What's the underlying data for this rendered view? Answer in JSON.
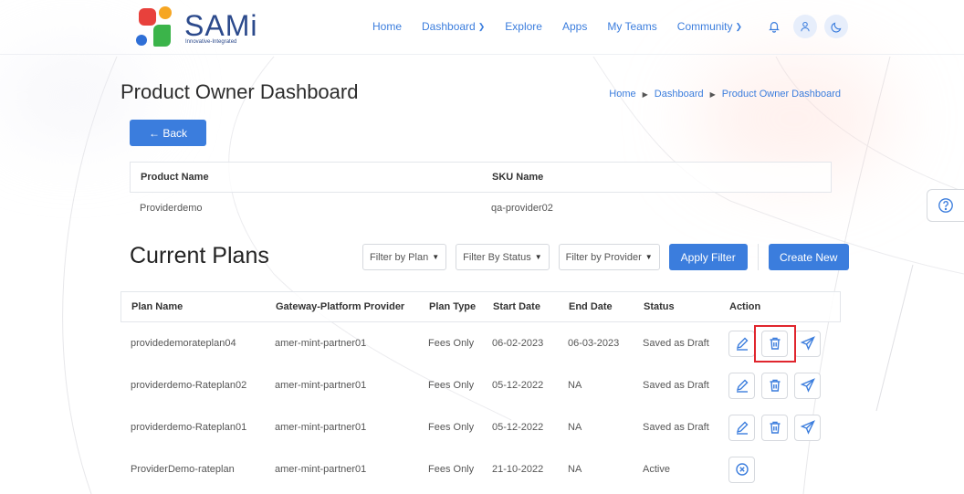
{
  "brand": {
    "name": "SAMi",
    "tagline": "Innovative-Integrated"
  },
  "nav": {
    "items": [
      {
        "label": "Home",
        "dropdown": false
      },
      {
        "label": "Dashboard",
        "dropdown": true
      },
      {
        "label": "Explore",
        "dropdown": false
      },
      {
        "label": "Apps",
        "dropdown": false
      },
      {
        "label": "My Teams",
        "dropdown": false
      },
      {
        "label": "Community",
        "dropdown": true
      }
    ],
    "icons": [
      "bell-icon",
      "user-icon",
      "moon-icon"
    ]
  },
  "page": {
    "title": "Product Owner Dashboard"
  },
  "breadcrumb": [
    "Home",
    "Dashboard",
    "Product Owner Dashboard"
  ],
  "back_button": "← Back",
  "product": {
    "headers": [
      "Product Name",
      "SKU Name"
    ],
    "values": [
      "Providerdemo",
      "qa-provider02"
    ]
  },
  "plans_section": {
    "title": "Current Plans",
    "filters": [
      "Filter by Plan",
      "Filter By Status",
      "Filter by Provider"
    ],
    "apply_label": "Apply Filter",
    "create_label": "Create New"
  },
  "plans_table": {
    "headers": [
      "Plan Name",
      "Gateway-Platform Provider",
      "Plan Type",
      "Start Date",
      "End Date",
      "Status",
      "Action"
    ],
    "rows": [
      {
        "plan": "providedemorateplan04",
        "provider": "amer-mint-partner01",
        "type": "Fees Only",
        "start": "06-02-2023",
        "end": "06-03-2023",
        "status": "Saved as Draft",
        "actions": [
          "edit",
          "delete",
          "send"
        ]
      },
      {
        "plan": "providerdemo-Rateplan02",
        "provider": "amer-mint-partner01",
        "type": "Fees Only",
        "start": "05-12-2022",
        "end": "NA",
        "status": "Saved as Draft",
        "actions": [
          "edit",
          "delete",
          "send"
        ]
      },
      {
        "plan": "providerdemo-Rateplan01",
        "provider": "amer-mint-partner01",
        "type": "Fees Only",
        "start": "05-12-2022",
        "end": "NA",
        "status": "Saved as Draft",
        "actions": [
          "edit",
          "delete",
          "send"
        ]
      },
      {
        "plan": "ProviderDemo-rateplan",
        "provider": "amer-mint-partner01",
        "type": "Fees Only",
        "start": "21-10-2022",
        "end": "NA",
        "status": "Active",
        "actions": [
          "cancel"
        ]
      }
    ]
  },
  "colors": {
    "accent": "#3b7ddd",
    "highlight": "#e0262e",
    "logo_orange": "#f6a623",
    "logo_red": "#e8413c",
    "logo_blue": "#2f6fd6",
    "logo_green": "#3bb44a"
  }
}
